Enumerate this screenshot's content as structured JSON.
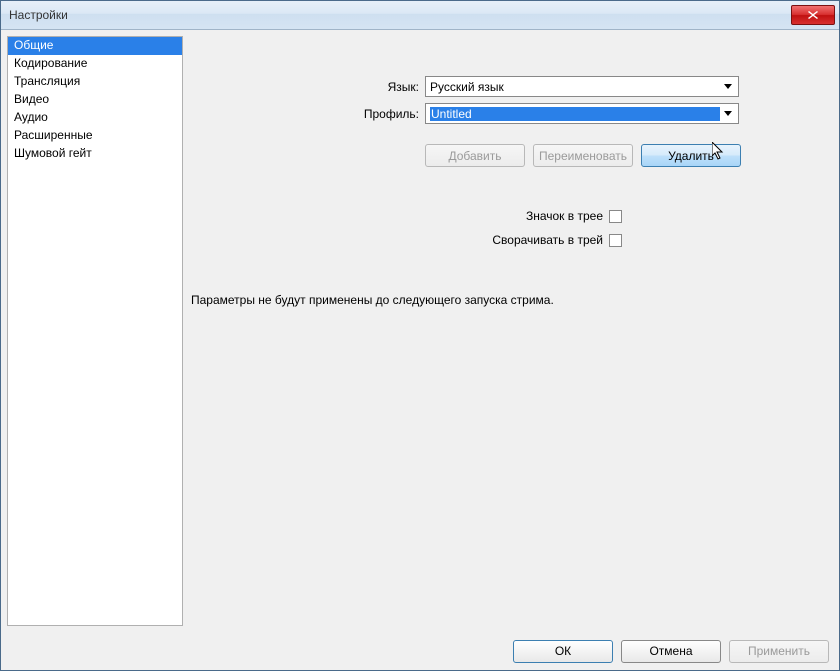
{
  "title": "Настройки",
  "sidebar": {
    "items": [
      {
        "label": "Общие",
        "selected": true
      },
      {
        "label": "Кодирование",
        "selected": false
      },
      {
        "label": "Трансляция",
        "selected": false
      },
      {
        "label": "Видео",
        "selected": false
      },
      {
        "label": "Аудио",
        "selected": false
      },
      {
        "label": "Расширенные",
        "selected": false
      },
      {
        "label": "Шумовой гейт",
        "selected": false
      }
    ]
  },
  "form": {
    "language_label": "Язык:",
    "language_value": "Русский язык",
    "profile_label": "Профиль:",
    "profile_value": "Untitled"
  },
  "buttons": {
    "add": "Добавить",
    "rename": "Переименовать",
    "delete": "Удалить"
  },
  "checks": {
    "tray_icon_label": "Значок в трее",
    "minimize_tray_label": "Сворачивать в трей"
  },
  "note": "Параметры не будут применены до следующего запуска стрима.",
  "footer": {
    "ok": "ОК",
    "cancel": "Отмена",
    "apply": "Применить"
  }
}
